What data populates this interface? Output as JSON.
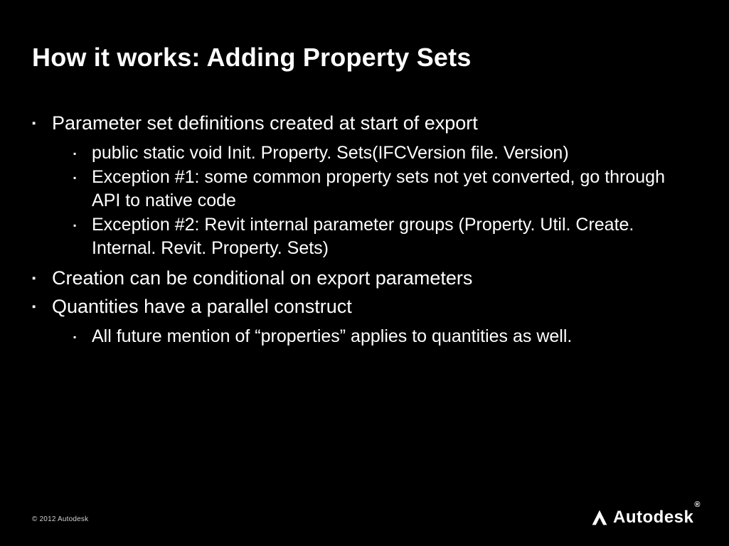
{
  "title": "How it works: Adding Property Sets",
  "bullets": {
    "b1": "Parameter set definitions created at start of export",
    "b1_sub": {
      "s1": "public static void Init. Property. Sets(IFCVersion file. Version)",
      "s2": "Exception #1: some common property sets not yet converted, go through API to native code",
      "s3": "Exception #2: Revit internal parameter groups (Property. Util. Create. Internal. Revit. Property. Sets)"
    },
    "b2": "Creation can be conditional on export parameters",
    "b3": "Quantities have a parallel construct",
    "b3_sub": {
      "s1": "All future mention of “properties” applies to quantities as well."
    }
  },
  "footer": "© 2012 Autodesk",
  "logo_text": "Autodesk",
  "reg_mark": "®"
}
